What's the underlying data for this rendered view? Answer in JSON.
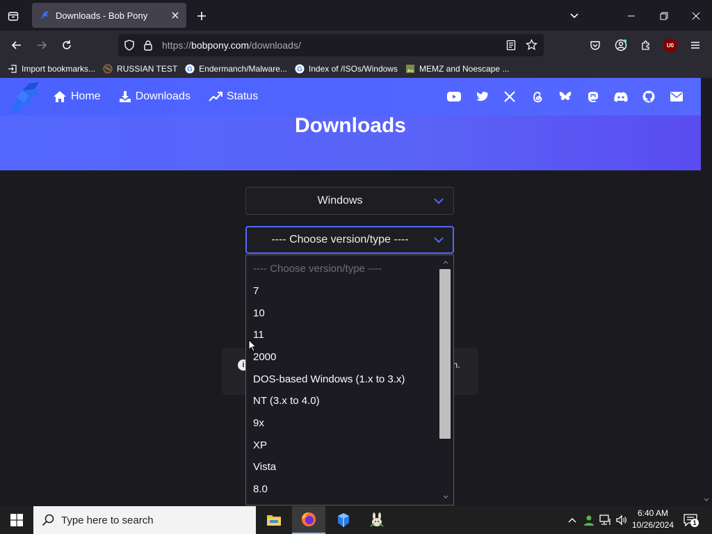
{
  "browser": {
    "tab_title": "Downloads - Bob Pony",
    "url_prefix": "https://",
    "url_host": "bobpony.com",
    "url_path": "/downloads/",
    "bookmarks": [
      {
        "label": "Import bookmarks...",
        "icon": "import-icon"
      },
      {
        "label": "RUSSIAN TEST",
        "icon": "globe-icon"
      },
      {
        "label": "Endermanch/Malware...",
        "icon": "google-icon"
      },
      {
        "label": "Index of /ISOs/Windows",
        "icon": "google-icon"
      },
      {
        "label": "MEMZ and Noescape ...",
        "icon": "image-icon"
      }
    ],
    "extension_badge": "U0"
  },
  "site": {
    "nav": {
      "home": "Home",
      "downloads": "Downloads",
      "status": "Status"
    },
    "social_icons": [
      "youtube-icon",
      "twitter-icon",
      "x-icon",
      "threads-icon",
      "bluesky-icon",
      "mastodon-icon",
      "discord-icon",
      "github-icon",
      "mail-icon"
    ],
    "heading": "Downloads",
    "os_select": {
      "value": "Windows"
    },
    "version_select": {
      "value": "---- Choose version/type ----"
    },
    "alert_tail": "n.",
    "alert_icon": "i",
    "dropdown": {
      "placeholder": "---- Choose version/type ----",
      "options": [
        "7",
        "10",
        "11",
        "2000",
        "DOS-based Windows (1.x to 3.x)",
        "NT (3.x to 4.0)",
        "9x",
        "XP",
        "Vista",
        "8.0"
      ]
    }
  },
  "taskbar": {
    "search_placeholder": "Type here to search",
    "time": "6:40 AM",
    "date": "10/26/2024",
    "notification_count": "1"
  },
  "colors": {
    "accent": "#5468ff",
    "firefox_dark": "#1c1b22",
    "toolbar": "#2b2a33"
  }
}
